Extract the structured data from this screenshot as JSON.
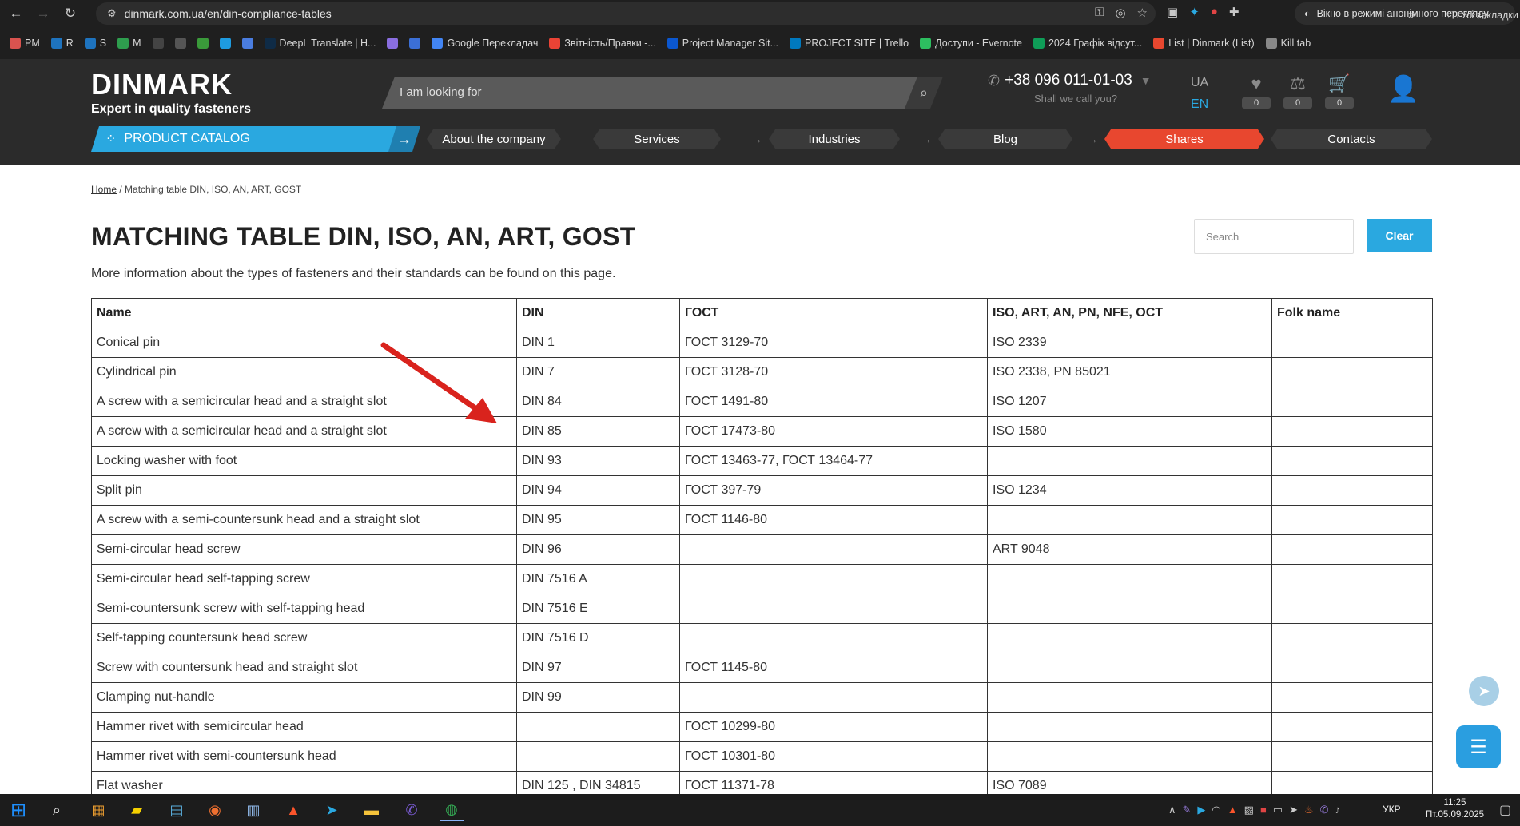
{
  "browser": {
    "url": "dinmark.com.ua/en/din-compliance-tables",
    "incognito_label": "Вікно в режимі анонімного перегляду",
    "bookmarks": [
      {
        "label": "PM",
        "color": "#d9534f"
      },
      {
        "label": "R",
        "color": "#1e73be"
      },
      {
        "label": "S",
        "color": "#1e73be"
      },
      {
        "label": "M",
        "color": "#2e9e4e"
      },
      {
        "label": "",
        "color": "#444"
      },
      {
        "label": "",
        "color": "#555"
      },
      {
        "label": "",
        "color": "#3a9a3a"
      },
      {
        "label": "",
        "color": "#1e9be0"
      },
      {
        "label": "",
        "color": "#4a7de0"
      },
      {
        "label": "DeepL Translate | H...",
        "color": "#0f2b46"
      },
      {
        "label": "",
        "color": "#8a6ee0"
      },
      {
        "label": "",
        "color": "#3b6fd6"
      },
      {
        "label": "Google Перекладач",
        "color": "#4285f4"
      },
      {
        "label": "Звітність/Правки -...",
        "color": "#ea4335"
      },
      {
        "label": "Project Manager Sit...",
        "color": "#0b57d0"
      },
      {
        "label": "PROJECT SITE | Trello",
        "color": "#0079bf"
      },
      {
        "label": "Доступи - Evernote",
        "color": "#2dbe60"
      },
      {
        "label": "2024 Графік відсут...",
        "color": "#0f9d58"
      },
      {
        "label": "List | Dinmark (List)",
        "color": "#e8472f"
      },
      {
        "label": "Kill tab",
        "color": "#888"
      }
    ],
    "all_bookmarks_label": "Усі закладки"
  },
  "header": {
    "logo_word": "DINMARK",
    "logo_tagline": "Expert in quality fasteners",
    "search_placeholder": "I am looking for",
    "phone": "+38 096 011-01-03",
    "callback": "Shall we call you?",
    "lang_ua": "UA",
    "lang_en": "EN",
    "wishlist_count": "0",
    "compare_count": "0",
    "cart_count": "0"
  },
  "menu": {
    "catalog": "PRODUCT CATALOG",
    "about": "About the company",
    "services": "Services",
    "industries": "Industries",
    "blog": "Blog",
    "shares": "Shares",
    "contacts": "Contacts"
  },
  "breadcrumb": {
    "home": "Home",
    "separator": "/",
    "current": "Matching table DIN, ISO, AN, ART, GOST"
  },
  "page": {
    "title": "MATCHING TABLE DIN, ISO, AN, ART, GOST",
    "intro": "More information about the types of fasteners and their standards can be found on this page.",
    "filter_placeholder": "Search",
    "clear_label": "Clear"
  },
  "table": {
    "headers": [
      "Name",
      "DIN",
      "ГОСТ",
      "ISO, ART, AN, PN, NFE, OCT",
      "Folk name"
    ],
    "rows": [
      [
        "Conical pin",
        "DIN 1",
        "ГОСТ 3129-70",
        "ISO 2339",
        ""
      ],
      [
        "Cylindrical pin",
        "DIN 7",
        "ГОСТ 3128-70",
        "ISO 2338, PN 85021",
        ""
      ],
      [
        "A screw with a semicircular head and a straight slot",
        "DIN 84",
        "ГОСТ 1491-80",
        "ISO 1207",
        ""
      ],
      [
        "A screw with a semicircular head and a straight slot",
        "DIN 85",
        "ГОСТ 17473-80",
        "ISO 1580",
        ""
      ],
      [
        "Locking washer with foot",
        "DIN 93",
        "ГОСТ 13463-77, ГОСТ 13464-77",
        "",
        ""
      ],
      [
        "Split pin",
        "DIN 94",
        "ГОСТ 397-79",
        "ISO 1234",
        ""
      ],
      [
        "A screw with a semi-countersunk head and a straight slot",
        "DIN 95",
        "ГОСТ 1146-80",
        "",
        ""
      ],
      [
        "Semi-circular head screw",
        "DIN 96",
        "",
        "ART 9048",
        ""
      ],
      [
        "Semi-circular head self-tapping screw",
        "DIN 7516 A",
        "",
        "",
        ""
      ],
      [
        "Semi-countersunk screw with self-tapping head",
        "DIN 7516 E",
        "",
        "",
        ""
      ],
      [
        "Self-tapping countersunk head screw",
        "DIN 7516 D",
        "",
        "",
        ""
      ],
      [
        "Screw with countersunk head and straight slot",
        "DIN 97",
        "ГОСТ 1145-80",
        "",
        ""
      ],
      [
        "Clamping nut-handle",
        "DIN 99",
        "",
        "",
        ""
      ],
      [
        "Hammer rivet with semicircular head",
        "",
        "ГОСТ 10299-80",
        "",
        ""
      ],
      [
        "Hammer rivet with semi-countersunk head",
        "",
        "ГОСТ 10301-80",
        "",
        ""
      ],
      [
        "Flat washer",
        "DIN 125 , DIN 34815",
        "ГОСТ 11371-78",
        "ISO 7089",
        ""
      ]
    ]
  },
  "taskbar": {
    "lang": "УКР",
    "time": "11:25",
    "date": "Пт.05.09.2025"
  },
  "colors": {
    "accent": "#2aa8e0",
    "shares": "#e8472f",
    "header_bg": "#2b2b2b",
    "annotation_arrow": "#d9231d"
  }
}
